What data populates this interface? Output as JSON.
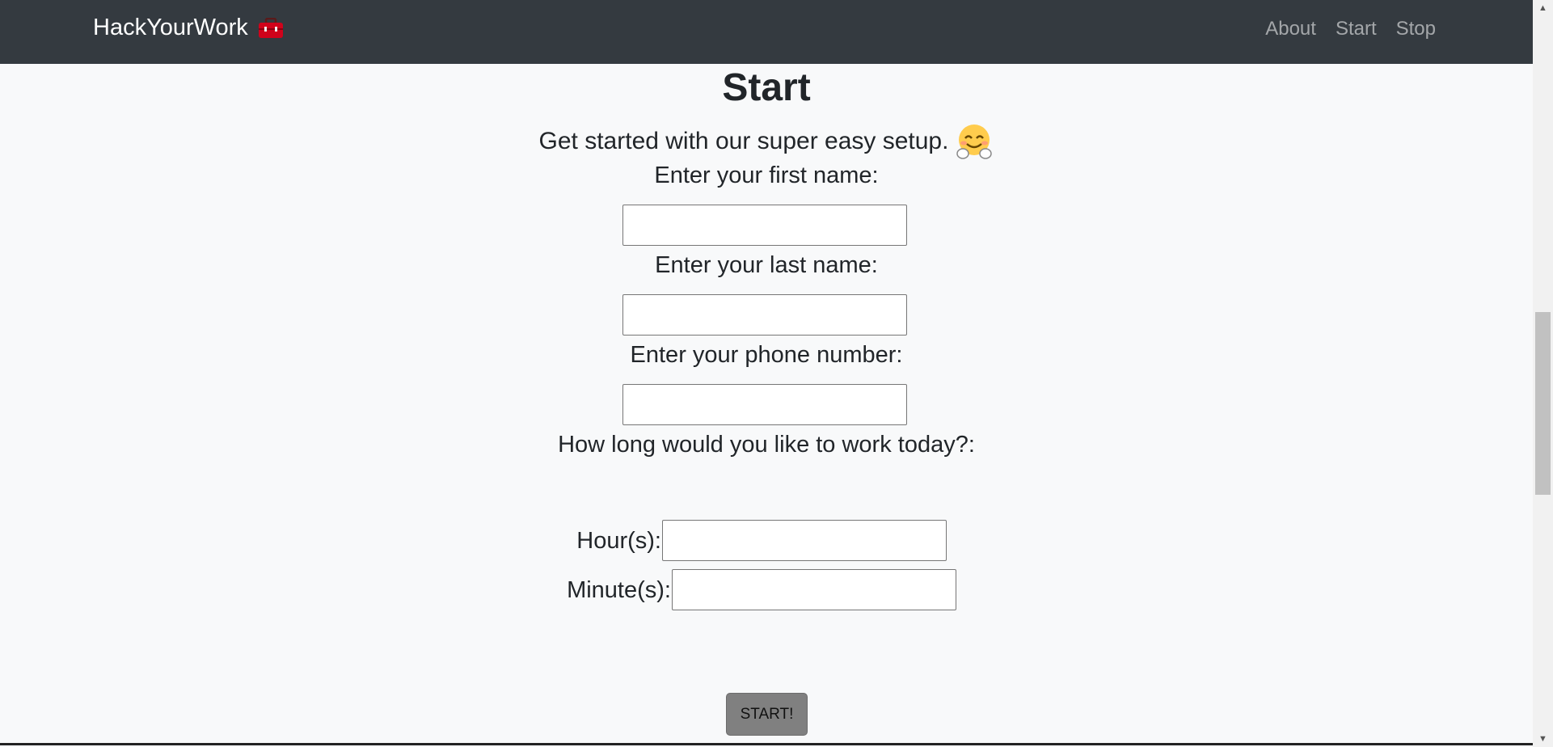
{
  "navbar": {
    "brand": "HackYourWork",
    "brand_icon": "toolbox-icon",
    "links": [
      "About",
      "Start",
      "Stop"
    ]
  },
  "main": {
    "title": "Start",
    "subtitle": "Get started with our super easy setup.",
    "subtitle_icon": "hugging-face-emoji",
    "first_name_label": "Enter your first name:",
    "first_name_value": "",
    "last_name_label": "Enter your last name:",
    "last_name_value": "",
    "phone_label": "Enter your phone number:",
    "phone_value": "",
    "duration_label": "How long would you like to work today?:",
    "hours_label": "Hour(s):",
    "hours_value": "",
    "minutes_label": "Minute(s):",
    "minutes_value": "",
    "submit_label": "START!"
  },
  "colors": {
    "navbar_bg": "#343a40",
    "page_bg": "#f8f9fa",
    "button_bg": "#808080",
    "toolbox_red": "#d0021b"
  }
}
